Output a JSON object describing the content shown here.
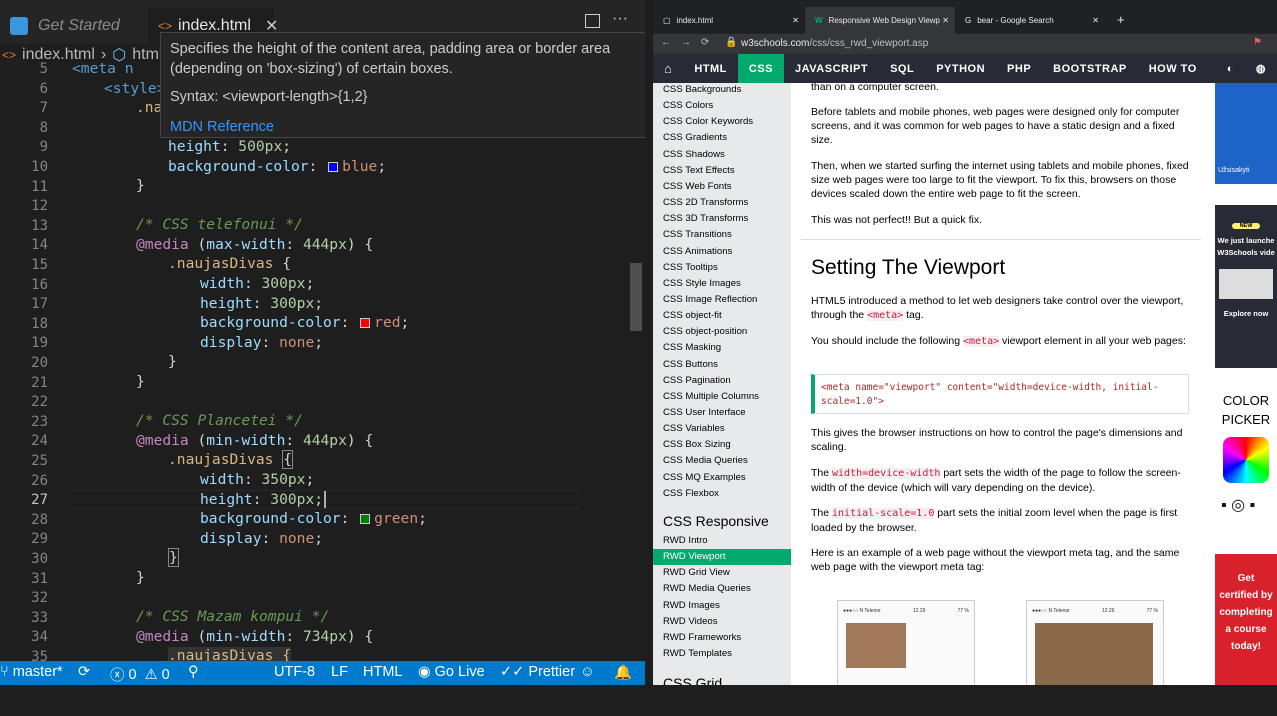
{
  "editor": {
    "tab_inactive": "Get Started",
    "tab_active": "index.html",
    "breadcrumb_file": "index.html",
    "breadcrumb_element": "html",
    "hover": {
      "desc_line1": "Specifies the height of the content area, padding area or border area",
      "desc_line2": "(depending on 'box-sizing') of certain boxes.",
      "syntax": "Syntax: <viewport-length>{1,2}",
      "link": "MDN Reference"
    },
    "line_numbers": [
      "5",
      "6",
      "7",
      "8",
      "9",
      "10",
      "11",
      "12",
      "13",
      "14",
      "15",
      "16",
      "17",
      "18",
      "19",
      "20",
      "21",
      "22",
      "23",
      "24",
      "25",
      "26",
      "27",
      "28",
      "29",
      "30",
      "31",
      "32",
      "33",
      "34",
      "35"
    ],
    "current_line": "27",
    "lines": {
      "l5": "<meta n",
      "l6": "<style>",
      "l7": ".na",
      "l9a": "height",
      "l9b": "500px",
      "l10a": "background-color",
      "l10b": "blue",
      "l13": "/* CSS telefonui */",
      "l14a": "@media",
      "l14b": "max-width",
      "l14c": "444px",
      "l15": ".naujasDivas",
      "l16a": "width",
      "l16b": "300px",
      "l17a": "height",
      "l17b": "300px",
      "l18a": "background-color",
      "l18b": "red",
      "l19a": "display",
      "l19b": "none",
      "l23": "/* CSS Plancetei */",
      "l24b": "min-width",
      "l24c": "444px",
      "l26b": "350px",
      "l27b": "300px",
      "l28b": "green",
      "l33": "/* CSS Mazam kompui */",
      "l34c": "734px",
      "l35": ".naujasDivas {"
    },
    "swatch_colors": {
      "blue": "#0000ff",
      "red": "#ff0000",
      "green": "#008000"
    }
  },
  "statusbar": {
    "branch": "master*",
    "errors": "0",
    "warnings": "0",
    "encoding": "UTF-8",
    "eol": "LF",
    "language": "HTML",
    "golive": "Go Live",
    "prettier": "Prettier"
  },
  "browser": {
    "tabs": [
      "index.html",
      "Responsive Web Design Viewp",
      "bear - Google Search"
    ],
    "url_host": "w3schools.com",
    "url_path": "/css/css_rwd_viewport.asp",
    "nav": [
      "HTML",
      "CSS",
      "JAVASCRIPT",
      "SQL",
      "PYTHON",
      "PHP",
      "BOOTSTRAP",
      "HOW TO"
    ],
    "leftnav": [
      "CSS Backgrounds",
      "CSS Colors",
      "CSS Color Keywords",
      "CSS Gradients",
      "CSS Shadows",
      "CSS Text Effects",
      "CSS Web Fonts",
      "CSS 2D Transforms",
      "CSS 3D Transforms",
      "CSS Transitions",
      "CSS Animations",
      "CSS Tooltips",
      "CSS Style Images",
      "CSS Image Reflection",
      "CSS object-fit",
      "CSS object-position",
      "CSS Masking",
      "CSS Buttons",
      "CSS Pagination",
      "CSS Multiple Columns",
      "CSS User Interface",
      "CSS Variables",
      "CSS Box Sizing",
      "CSS Media Queries",
      "CSS MQ Examples",
      "CSS Flexbox"
    ],
    "section_responsive": "CSS Responsive",
    "rwd": [
      "RWD Intro",
      "RWD Viewport",
      "RWD Grid View",
      "RWD Media Queries",
      "RWD Images",
      "RWD Videos",
      "RWD Frameworks",
      "RWD Templates"
    ],
    "section_grid": "CSS Grid",
    "content": {
      "p0": "than on a computer screen.",
      "p1": "Before tablets and mobile phones, web pages were designed only for computer screens, and it was common for web pages to have a static design and a fixed size.",
      "p2": "Then, when we started surfing the internet using tablets and mobile phones, fixed size web pages were too large to fit the viewport. To fix this, browsers on those devices scaled down the entire web page to fit the screen.",
      "p3": "This was not perfect!! But a quick fix.",
      "h2": "Setting The Viewport",
      "p4a": "HTML5 introduced a method to let web designers take control over the viewport, through the",
      "p4code": "<meta>",
      "p4b": "tag.",
      "p5a": "You should include the following",
      "p5code": "<meta>",
      "p5b": "viewport element in all your web pages:",
      "code_line1": "<meta name=\"viewport\" content=\"width=device-width, initial-",
      "code_line2": "scale=1.0\">",
      "p6": "This gives the browser instructions on how to control the page's dimensions and scaling.",
      "p7a": "The",
      "p7code": "width=device-width",
      "p7b": "part sets the width of the page to follow the screen-width of the device (which will vary depending on the device).",
      "p8a": "The",
      "p8code": "initial-scale=1.0",
      "p8b": "part sets the initial zoom level when the page is first loaded by the browser.",
      "p9": "Here is an example of a web page without the viewport meta tag, and the same web page with the viewport meta tag:",
      "phone_carrier": "●●●○○ N Telenor",
      "phone_time": "12.29",
      "phone_batt": "77 %"
    },
    "ads": {
      "subscribe": "Užsisakyti",
      "new_badge": "NEW",
      "launch": "We just launche W3Schools vide",
      "explore": "Explore now",
      "color": "COLOR",
      "picker": "PICKER",
      "certified": "Get certified by completing a course today!"
    }
  }
}
